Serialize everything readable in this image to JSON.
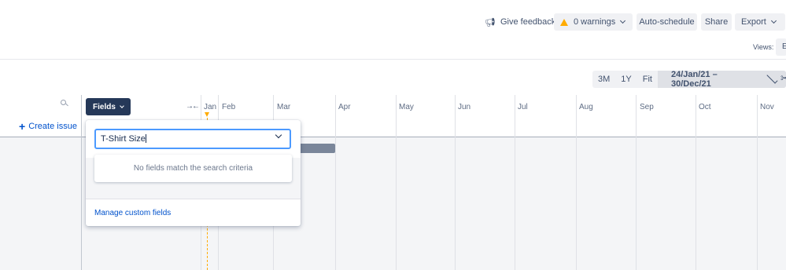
{
  "toolbar": {
    "feedback_label": "Give feedback",
    "warnings_label": "0 warnings",
    "autoschedule_label": "Auto-schedule",
    "share_label": "Share",
    "export_label": "Export",
    "views_label": "Views:",
    "views_value": "E"
  },
  "zoom": {
    "options": [
      "3M",
      "1Y",
      "Fit"
    ],
    "range": "24/Jan/21 – 30/Dec/21"
  },
  "left_panel": {
    "fields_label": "Fields",
    "create_issue_label": "Create issue"
  },
  "timeline": {
    "months": [
      "Jan",
      "Feb",
      "Mar",
      "Apr",
      "May",
      "Jun",
      "Jul",
      "Aug",
      "Sep",
      "Oct",
      "Nov"
    ]
  },
  "fields_dropdown": {
    "input_value": "T-Shirt Size",
    "empty_message": "No fields match the search criteria",
    "manage_link": "Manage custom fields"
  },
  "colors": {
    "accent": "#0052cc",
    "focus": "#4c9aff",
    "fields_button": "#253858",
    "warning": "#ffab00"
  }
}
